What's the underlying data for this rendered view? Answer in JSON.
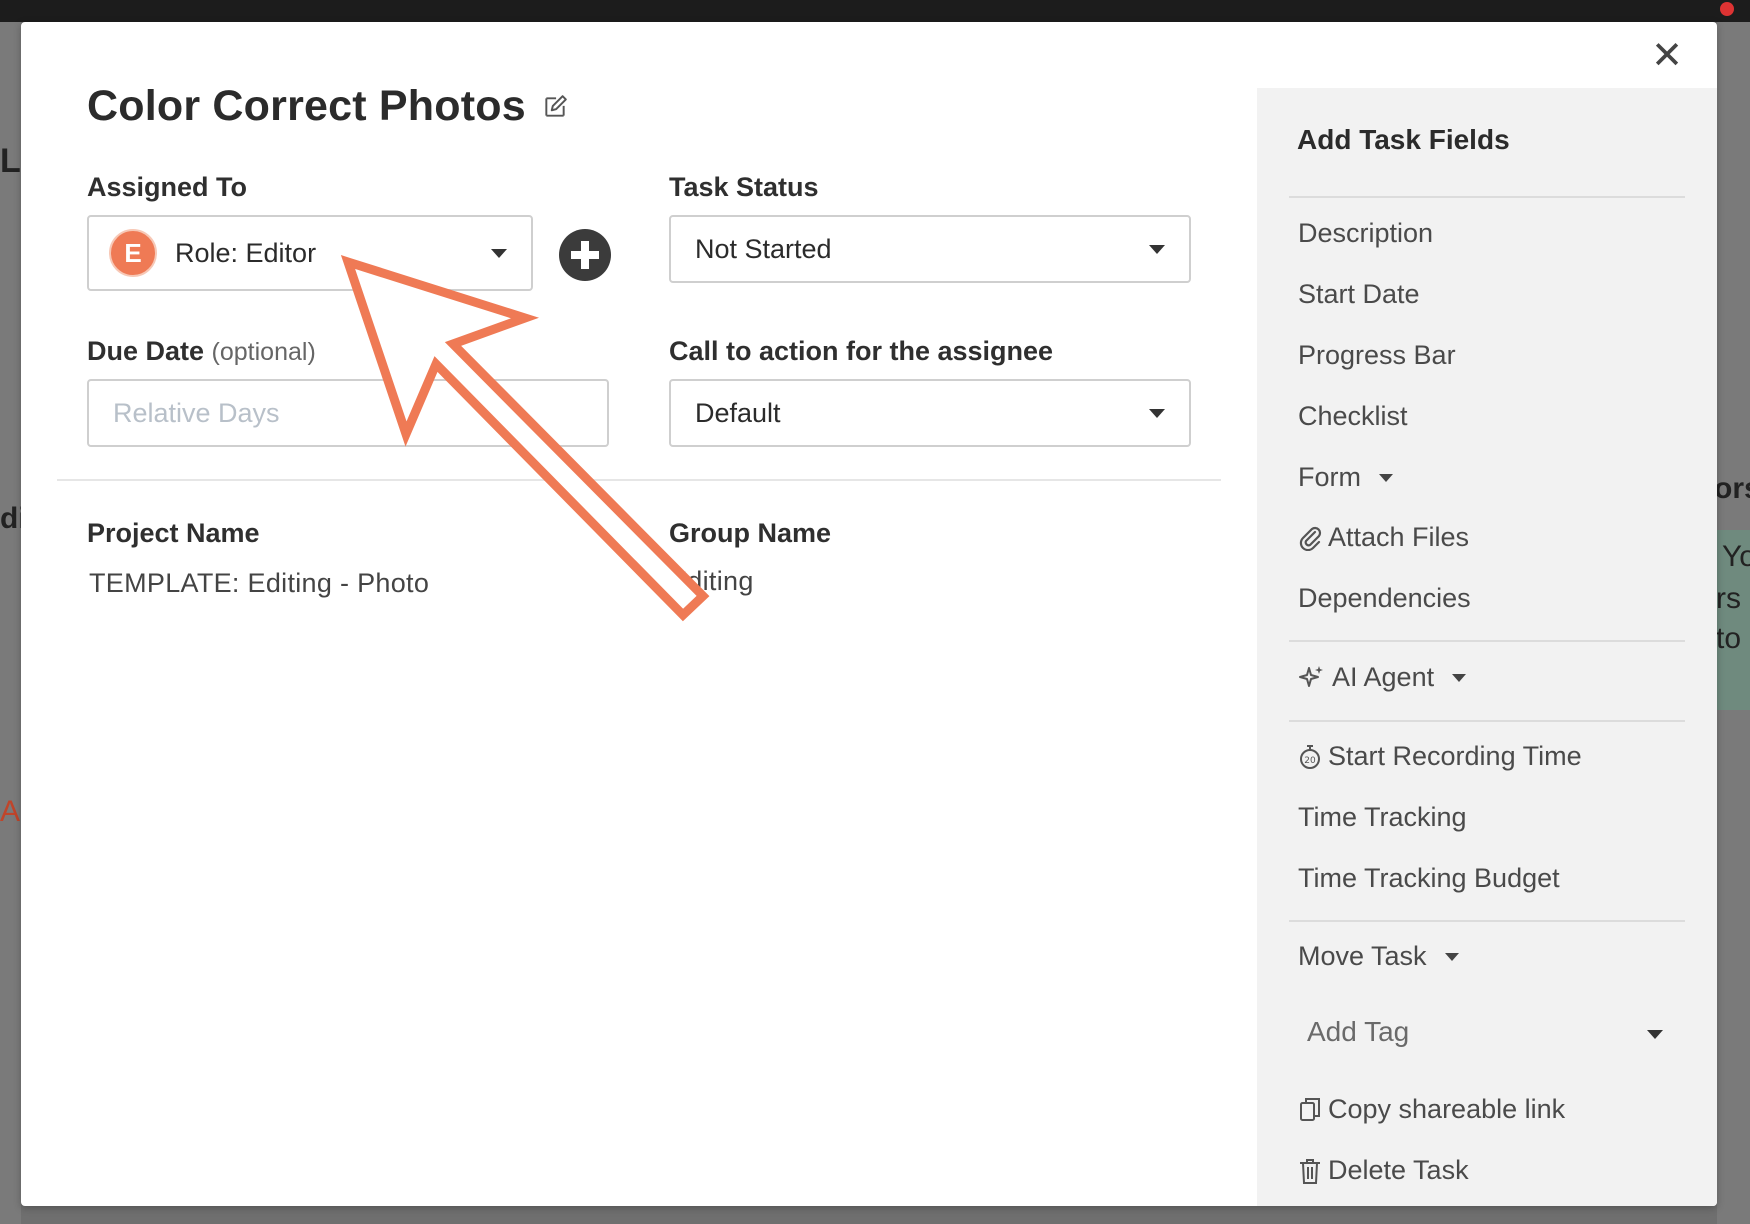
{
  "modal": {
    "title": "Color Correct Photos",
    "close_label": "✕"
  },
  "assigned_to": {
    "label": "Assigned To",
    "avatar_letter": "E",
    "value": "Role: Editor"
  },
  "task_status": {
    "label": "Task Status",
    "value": "Not Started"
  },
  "due_date": {
    "label": "Due Date",
    "optional": "(optional)",
    "placeholder": "Relative Days"
  },
  "call_to_action": {
    "label": "Call to action for the assignee",
    "value": "Default"
  },
  "project": {
    "label": "Project Name",
    "value": "TEMPLATE: Editing - Photo"
  },
  "group": {
    "label": "Group Name",
    "value": "Editing"
  },
  "side_panel": {
    "title": "Add Task Fields",
    "items": {
      "description": "Description",
      "start_date": "Start Date",
      "progress_bar": "Progress Bar",
      "checklist": "Checklist",
      "form": "Form",
      "attach_files": "Attach Files",
      "dependencies": "Dependencies",
      "ai_agent": "AI Agent",
      "start_recording": "Start Recording Time",
      "time_tracking": "Time Tracking",
      "time_tracking_budget": "Time Tracking Budget",
      "move_task": "Move Task",
      "add_tag": "Add Tag",
      "copy_link": "Copy shareable link",
      "delete_task": "Delete Task"
    }
  },
  "background_fragments": {
    "left_top": "L",
    "left_mid": "di",
    "left_low": "A",
    "right_a": "ors",
    "right_b": "Yo",
    "right_c": "rs",
    "right_d": "to"
  },
  "colors": {
    "accent": "#ef7a55",
    "annotation_arrow": "#ef7a55",
    "side_panel_bg": "#f2f2f2"
  }
}
